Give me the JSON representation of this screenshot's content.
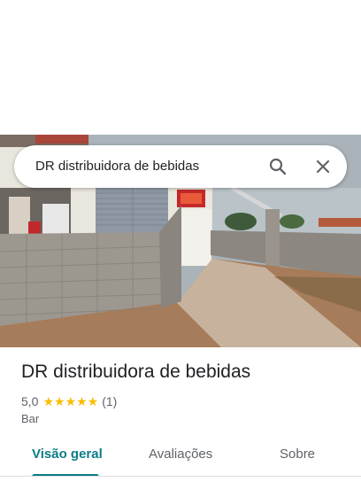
{
  "search": {
    "query": "DR distribuidora de bebidas"
  },
  "place": {
    "name": "DR distribuidora de bebidas",
    "rating": "5,0",
    "stars_count": 5,
    "stars": "★★★★★",
    "review_count": "(1)",
    "category": "Bar"
  },
  "tabs": [
    {
      "label": "Visão geral",
      "active": true
    },
    {
      "label": "Avaliações",
      "active": false
    },
    {
      "label": "Sobre",
      "active": false
    }
  ],
  "colors": {
    "accent": "#0b7c86",
    "star": "#fbbc04"
  },
  "icons": {
    "search": "search-icon",
    "close": "close-icon"
  }
}
